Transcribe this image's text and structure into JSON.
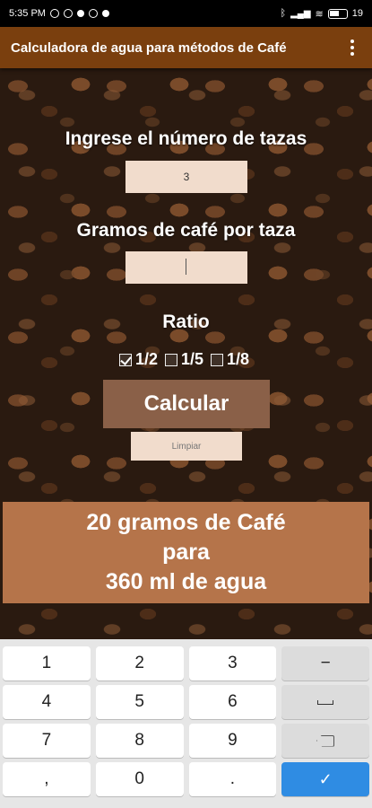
{
  "status": {
    "time": "5:35 PM",
    "battery": "19"
  },
  "appbar": {
    "title": "Calculadora de agua para métodos de Café"
  },
  "form": {
    "cups_label": "Ingrese el número de tazas",
    "cups_value": "3",
    "grams_label": "Gramos de café por taza",
    "grams_value": "",
    "ratio_label": "Ratio",
    "ratio_options": [
      {
        "label": "1/2",
        "checked": true
      },
      {
        "label": "1/5",
        "checked": false
      },
      {
        "label": "1/8",
        "checked": false
      }
    ],
    "calc_label": "Calcular",
    "clear_label": "Limpiar"
  },
  "result": {
    "line1": "20 gramos de Café",
    "line2": "para",
    "line3": "360  ml de agua"
  },
  "keyboard": {
    "keys": [
      "1",
      "2",
      "3",
      "−",
      "4",
      "5",
      "6",
      "",
      "7",
      "8",
      "9",
      "",
      ",",
      "0",
      ".",
      ""
    ]
  },
  "colors": {
    "appbar": "#7a3f0e",
    "calc_button": "#8a6048",
    "result_bg": "#b5744a",
    "field_bg": "#f1dccc",
    "enter_key": "#2f8ce3"
  }
}
